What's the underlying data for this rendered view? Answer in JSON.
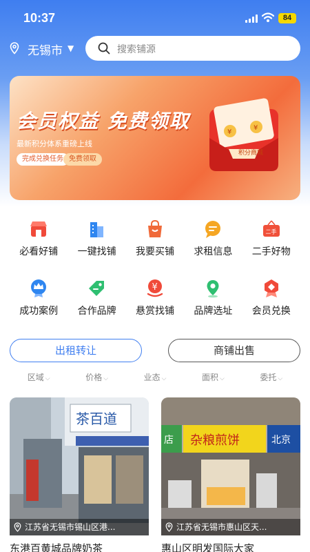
{
  "status_bar": {
    "time": "10:37",
    "battery": "84"
  },
  "header": {
    "city": "无锡市",
    "search_placeholder": "搜索铺源"
  },
  "banner": {
    "title": "会员权益 免费领取",
    "subtitle": "最新积分体系重磅上线",
    "task_label": "完成兑换任务",
    "free_label": "免费领取",
    "tag": "积分商城"
  },
  "categories_row1": [
    {
      "label": "必看好铺",
      "icon": "shop-icon"
    },
    {
      "label": "一键找铺",
      "icon": "building-icon"
    },
    {
      "label": "我要买铺",
      "icon": "shopping-bag-icon"
    },
    {
      "label": "求租信息",
      "icon": "chat-bubble-icon"
    },
    {
      "label": "二手好物",
      "icon": "second-hand-sign-icon"
    }
  ],
  "categories_row2": [
    {
      "label": "成功案例",
      "icon": "crown-badge-icon"
    },
    {
      "label": "合作品牌",
      "icon": "tag-icon"
    },
    {
      "label": "悬赏找铺",
      "icon": "reward-yuan-icon"
    },
    {
      "label": "品牌选址",
      "icon": "map-pin-icon"
    },
    {
      "label": "会员兑换",
      "icon": "medal-icon"
    }
  ],
  "tabs": {
    "rent": "出租转让",
    "sale": "商铺出售"
  },
  "filters": [
    "区域",
    "价格",
    "业态",
    "面积",
    "委托"
  ],
  "cards": [
    {
      "address": "江苏省无锡市锡山区港...",
      "title": "东港百黄城品牌奶茶"
    },
    {
      "address": "江苏省无锡市惠山区天...",
      "title": "惠山区明发国际大家"
    }
  ],
  "card_signs": {
    "left_sign": "茶百道",
    "right_sign_a": "店",
    "right_sign_b": "杂粮煎饼",
    "right_sign_c": "北京"
  },
  "colors": {
    "accent": "#3f7ef0",
    "icon_red": "#f04a3a",
    "icon_orange": "#f5a623",
    "icon_green": "#2fbf71",
    "icon_blue": "#2f86f0"
  }
}
